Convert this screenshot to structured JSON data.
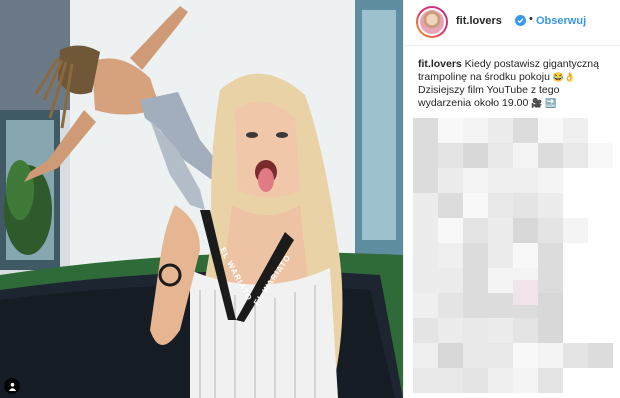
{
  "post": {
    "username": "fit.lovers",
    "dot": "•",
    "follow_label": "Obserwuj",
    "verified_icon": "verified-badge-icon",
    "caption_username": "fit.lovers",
    "caption_line1": " Kiedy postawisz gigantyczną",
    "caption_line2": "trampolinę na środku pokoju",
    "caption_emoji1": "😂👌",
    "caption_line3": "Dzisiejszy film YouTube z tego",
    "caption_line4": "wydarzenia około 19.00",
    "caption_emoji2": "🎥 🔜",
    "blurred_comments": "pixelated-comments"
  },
  "image": {
    "t_shirt_text": "EL WARIATO",
    "user_tag_icon": "user-tag-icon"
  },
  "colors": {
    "link_blue": "#3897f0",
    "verified_blue": "#3897f0",
    "text": "#262626"
  }
}
